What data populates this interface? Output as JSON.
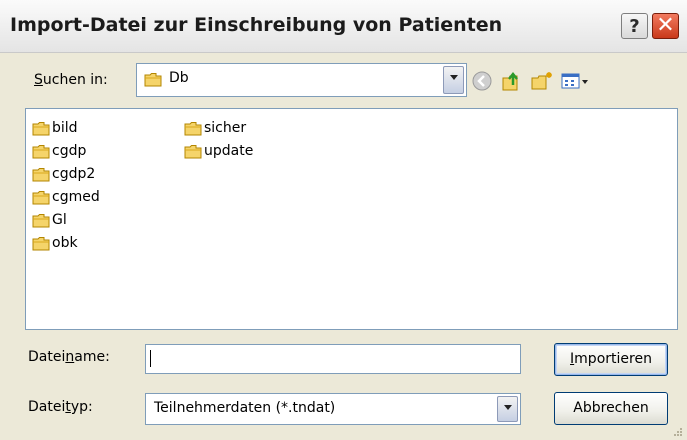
{
  "window": {
    "title": "Import-Datei zur Einschreibung von Patienten",
    "help_label": "?",
    "close_label": "✕"
  },
  "lookin": {
    "label_pre": "",
    "label_u": "S",
    "label_post": "uchen in:",
    "value": "Db"
  },
  "toolbar": {
    "back_icon": "back-icon",
    "up_icon": "up-folder-icon",
    "new_folder_icon": "new-folder-icon",
    "views_icon": "views-menu-icon"
  },
  "files": {
    "col1": [
      "bild",
      "cgdp",
      "cgdp2",
      "cgmed",
      "Gl",
      "obk"
    ],
    "col2": [
      "sicher",
      "update"
    ]
  },
  "filename": {
    "label_pre": "Datei",
    "label_u": "n",
    "label_post": "ame:",
    "value": ""
  },
  "filetype": {
    "label_pre": "Datei",
    "label_u": "t",
    "label_post": "yp:",
    "value": "Teilnehmerdaten (*.tndat)"
  },
  "buttons": {
    "import": {
      "pre": "",
      "u": "I",
      "post": "mportieren"
    },
    "cancel": "Abbrechen"
  },
  "colors": {
    "accent": "#7f9db9",
    "dialog_bg": "#ece9d8",
    "close": "#c9391a"
  }
}
